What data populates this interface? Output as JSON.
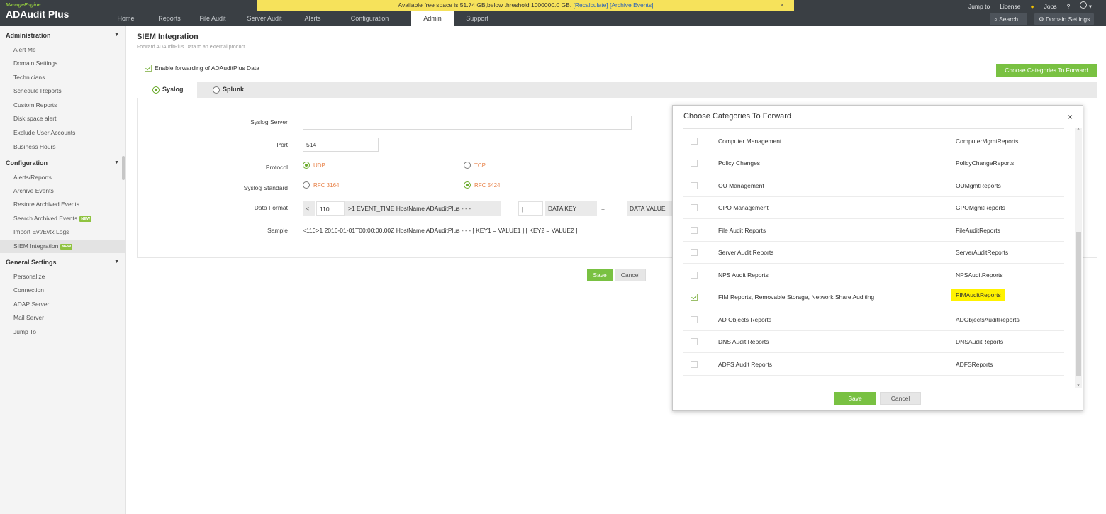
{
  "brand": {
    "vendor": "ManageEngine",
    "product": "ADAudit Plus"
  },
  "nav": {
    "items": [
      "Home",
      "Reports",
      "File Audit",
      "Server Audit",
      "Alerts",
      "Configuration",
      "Admin",
      "Support"
    ],
    "active": "Admin"
  },
  "alert_bar": {
    "text": "Available free space is 51.74 GB,below threshold 1000000.0 GB. ",
    "recalculate": "[Recalculate]",
    "archive": "[Archive Events]",
    "close": "×"
  },
  "top_right": {
    "jump_to": "Jump to",
    "license": "License",
    "jobs": "Jobs",
    "help": "?",
    "search": "Search...",
    "domain_settings": "Domain Settings"
  },
  "sidebar": {
    "administration": {
      "title": "Administration",
      "items": [
        "Alert Me",
        "Domain Settings",
        "Technicians",
        "Schedule Reports",
        "Custom Reports",
        "Disk space alert",
        "Exclude User Accounts",
        "Business Hours"
      ]
    },
    "configuration": {
      "title": "Configuration",
      "items": [
        "Alerts/Reports",
        "Archive Events",
        "Restore Archived Events",
        "Search Archived Events",
        "Import Evt/Evtx Logs",
        "SIEM Integration"
      ],
      "new_badge": "NEW"
    },
    "general": {
      "title": "General Settings",
      "items": [
        "Personalize",
        "Connection",
        "ADAP Server",
        "Mail Server",
        "Jump To"
      ]
    }
  },
  "page": {
    "title": "SIEM Integration",
    "subtitle": "Forward ADAuditPlus Data to an external product",
    "enable_label": "Enable forwarding of ADAuditPlus Data",
    "choose_button": "Choose Categories To Forward",
    "tabs": [
      "Syslog",
      "Splunk"
    ],
    "form": {
      "syslog_server_label": "Syslog Server",
      "syslog_server_value": "",
      "port_label": "Port",
      "port_value": "514",
      "protocol_label": "Protocol",
      "protocol_options": [
        "UDP",
        "TCP"
      ],
      "standard_label": "Syslog Standard",
      "standard_options": [
        "RFC 3164",
        "RFC 5424"
      ],
      "data_format_label": "Data Format",
      "df_lt": "<",
      "df_priority": "110",
      "df_header": ">1 EVENT_TIME HostName ADAuditPlus - - -",
      "df_sep": "|",
      "df_key": "DATA KEY",
      "df_eq": "=",
      "df_value": "DATA VALUE",
      "sample_label": "Sample",
      "sample_value": "<110>1 2016-01-01T00:00:00.00Z HostName ADAuditPlus - - - [ KEY1 = VALUE1 ] [ KEY2 = VALUE2 ]"
    },
    "save": "Save",
    "cancel": "Cancel"
  },
  "modal": {
    "title": "Choose Categories To Forward",
    "close": "×",
    "rows": [
      {
        "name": "Computer Management",
        "code": "ComputerMgmtReports",
        "checked": false
      },
      {
        "name": "Policy Changes",
        "code": "PolicyChangeReports",
        "checked": false
      },
      {
        "name": "OU Management",
        "code": "OUMgmtReports",
        "checked": false
      },
      {
        "name": "GPO Management",
        "code": "GPOMgmtReports",
        "checked": false
      },
      {
        "name": "File Audit Reports",
        "code": "FileAuditReports",
        "checked": false
      },
      {
        "name": "Server Audit Reports",
        "code": "ServerAuditReports",
        "checked": false
      },
      {
        "name": "NPS Audit Reports",
        "code": "NPSAuditReports",
        "checked": false
      },
      {
        "name": "FIM Reports, Removable Storage, Network Share Auditing",
        "code": "FIMAuditReports",
        "checked": true,
        "highlight": "#fff200"
      },
      {
        "name": "AD Objects Reports",
        "code": "ADObjectsAuditReports",
        "checked": false
      },
      {
        "name": "DNS Audit Reports",
        "code": "DNSAuditReports",
        "checked": false
      },
      {
        "name": "ADFS Audit Reports",
        "code": "ADFSReports",
        "checked": false
      }
    ],
    "save": "Save",
    "cancel": "Cancel"
  },
  "colors": {
    "accent_green": "#79c142",
    "topbar": "#3a3f44",
    "alert_yellow": "#f6e25b",
    "option_orange": "#e8834a"
  }
}
